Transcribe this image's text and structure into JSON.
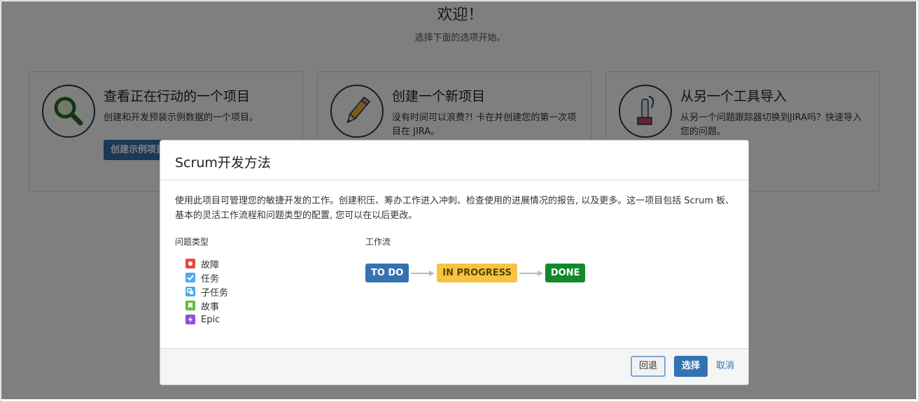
{
  "welcome": {
    "title": "欢迎！",
    "subtitle": "选择下面的选项开始。"
  },
  "cards": [
    {
      "title": "查看正在行动的一个项目",
      "description": "创建和开发预装示例数据的一个项目。",
      "button": "创建示例项目",
      "icon": "magnifier-icon"
    },
    {
      "title": "创建一个新项目",
      "description": "没有时间可以浪费?! 卡在并创建您的第一次项目在 JIRA。",
      "icon": "pencil-icon"
    },
    {
      "title": "从另一个工具导入",
      "description": "从另一个问题跟踪器切换到JIRA吗？快速导入您的问题。",
      "icon": "vacuum-cleaner-icon"
    }
  ],
  "dialog": {
    "title": "Scrum开发方法",
    "description": "使用此项目可管理您的敏捷开发的工作。创建积压、筹办工作进入冲刺、检查使用的进展情况的报告, 以及更多。这一项目包括 Scrum 板、基本的灵活工作流程和问题类型的配置, 您可以在以后更改。",
    "issue_types_label": "问题类型",
    "workflow_label": "工作流",
    "issue_types": [
      {
        "label": "故障",
        "icon": "bug-icon",
        "color": "#e5493a"
      },
      {
        "label": "任务",
        "icon": "task-icon",
        "color": "#4bade8"
      },
      {
        "label": "子任务",
        "icon": "subtask-icon",
        "color": "#4bade8"
      },
      {
        "label": "故事",
        "icon": "story-icon",
        "color": "#63ba3c"
      },
      {
        "label": "Epic",
        "icon": "epic-icon",
        "color": "#904ee2"
      }
    ],
    "workflow": [
      {
        "label": "TO DO",
        "color": "#3572b0",
        "text_color": "#ffffff"
      },
      {
        "label": "IN PROGRESS",
        "color": "#f6c342",
        "text_color": "#594300"
      },
      {
        "label": "DONE",
        "color": "#14892c",
        "text_color": "#ffffff"
      }
    ],
    "buttons": {
      "back": "回退",
      "select": "选择",
      "cancel": "取消"
    }
  }
}
